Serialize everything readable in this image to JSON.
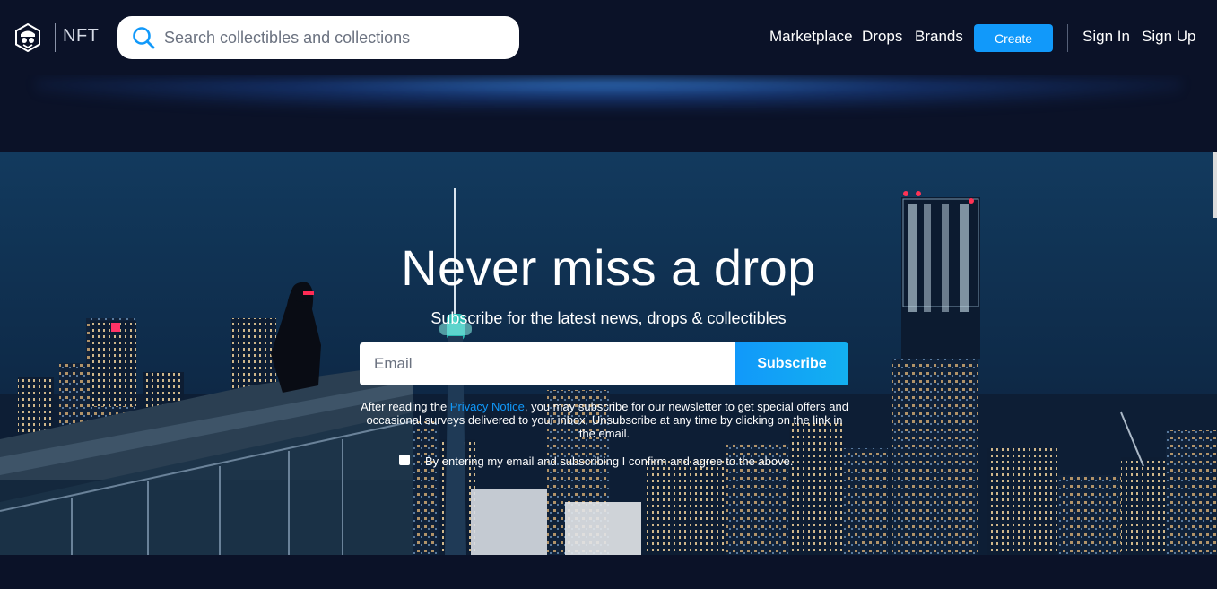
{
  "header": {
    "brand_label": "NFT",
    "search": {
      "placeholder": "Search collectibles and collections"
    },
    "nav": {
      "marketplace": "Marketplace",
      "drops": "Drops",
      "brands": "Brands",
      "create": "Create",
      "sign_in": "Sign In",
      "sign_up": "Sign Up"
    }
  },
  "hero": {
    "title": "Never miss a drop",
    "subtitle": "Subscribe for the latest news, drops & collectibles",
    "email_placeholder": "Email",
    "subscribe": "Subscribe",
    "legal_before": "After reading the ",
    "privacy_link": "Privacy Notice",
    "legal_after": ", you may subscribe for our newsletter to get special offers and occasional surveys delivered to your inbox. Unsubscribe at any time by clicking on the link in the email.",
    "consent_label": "By entering my email and subscribing I confirm and agree to the above."
  },
  "colors": {
    "accent": "#1199fa",
    "background": "#0b1228"
  },
  "icons": [
    "logo-icon",
    "search-icon"
  ]
}
